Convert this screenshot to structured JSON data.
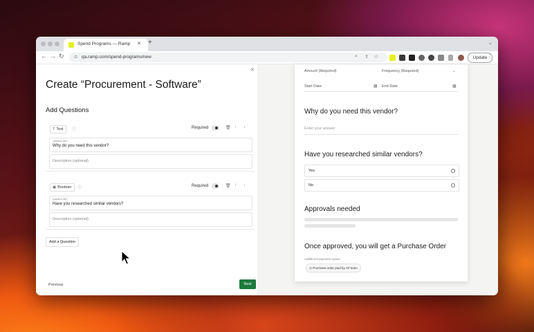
{
  "browser": {
    "tab_title": "Spend Programs — Ramp",
    "url": "qa.ramp.com/spend-programs/new",
    "update_label": "Update"
  },
  "form": {
    "title": "Create “Procurement - Software”",
    "section_title": "Add Questions",
    "questions": [
      {
        "type_label": "Text",
        "required_label": "Required",
        "title_label": "Question title *",
        "title_value": "Why do you need this vendor?",
        "description_placeholder": "Description (optional)"
      },
      {
        "type_label": "Boolean",
        "required_label": "Required",
        "title_label": "Question title *",
        "title_value": "Have you researched similar vendors?",
        "description_placeholder": "Description (optional)"
      }
    ],
    "add_question_label": "Add a Question",
    "previous_label": "Previous",
    "next_label": "Next"
  },
  "preview": {
    "amount_label": "Amount (Required)",
    "frequency_label": "Frequency (Required)",
    "start_date_label": "Start Date",
    "end_date_label": "End Date",
    "q1_heading": "Why do you need this vendor?",
    "q1_placeholder": "Enter your answer",
    "q2_heading": "Have you researched similar vendors?",
    "q2_options": [
      "Yes",
      "No"
    ],
    "approvals_heading": "Approvals needed",
    "po_heading": "Once approved, you will get a Purchase Order",
    "payment_label": "Additional payment option",
    "payment_chip": "Purchase order paid by AP team"
  },
  "colors": {
    "next_button": "#1d7a3c",
    "ramp_favicon": "#e4f222"
  }
}
